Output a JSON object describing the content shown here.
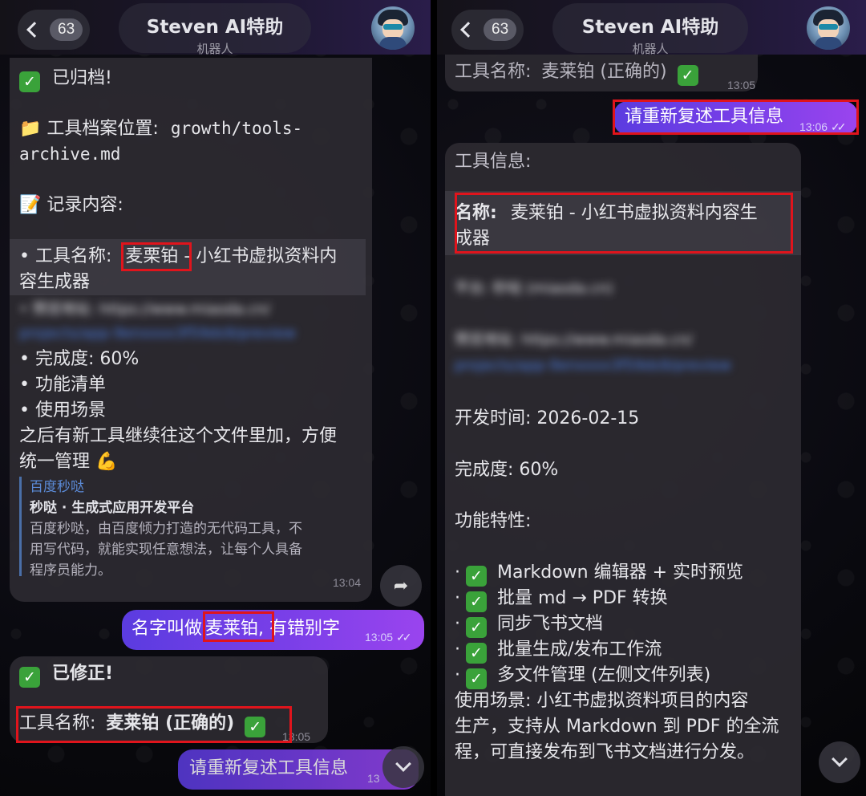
{
  "header": {
    "unread_count": "63",
    "chat_name": "Steven AI特助",
    "chat_subtitle": "机器人"
  },
  "left": {
    "archive_msg": {
      "line1": "已归档!",
      "loc_label": "📁 工具档案位置:",
      "loc_path_1": "growth/tools-",
      "loc_path_2": "archive.md",
      "record_label": "📝 记录内容:",
      "tool_name_prefix": "• 工具名称:",
      "tool_name_value": "麦栗铂",
      "tool_name_suffix": " - 小红书虚拟资料内",
      "tool_name_cont": "容生成器",
      "preview_blurred": "• 预览地址: https://www.miaoda.cn/",
      "preview_blurred_2": "projects/app-9enxxxx3f59ds9/preview",
      "completion": "• 完成度: 60%",
      "features": "• 功能清单",
      "scenarios": "• 使用场景",
      "footer_1": "之后有新工具继续往这个文件里加，方便",
      "footer_2": "统一管理 💪",
      "quote_title": "百度秒哒",
      "quote_head": "秒哒 · 生成式应用开发平台",
      "quote_body_1": "百度秒哒，由百度倾力打造的无代码工具，不",
      "quote_body_2": "用写代码，就能实现任意想法，让每个人具备",
      "quote_body_3": "程序员能力。",
      "time": "13:04"
    },
    "user_msg": {
      "prefix": "名字叫做",
      "highlight": "麦莱铂,",
      "suffix": " 有错别字",
      "time": "13:05"
    },
    "fixed_msg": {
      "line1": "已修正!",
      "label": "工具名称:",
      "value": "麦莱铂 (正确的)",
      "time": "13:05"
    },
    "partial_out": {
      "text": "请重新复述工具信息",
      "time": "13"
    }
  },
  "right": {
    "top_msg": {
      "label": "工具名称:",
      "value": "麦莱铂 (正确的)",
      "time": "13:05"
    },
    "out_msg": {
      "text": "请重新复述工具信息",
      "time": "13:06"
    },
    "info_msg": {
      "heading": "工具信息:",
      "name_label": "名称:",
      "name_value": "麦莱铂 - 小红书虚拟资料内容生",
      "name_cont": "成器",
      "platform_blurred": "平台: 秒哒 (miaoda.cn)",
      "preview_blurred_1": "预览地址: https://www.miaoda.cn/",
      "preview_blurred_2": "projects/app-9enxxxx3f59ds9/preview",
      "dev_time": "开发时间: 2026-02-15",
      "completion": "完成度: 60%",
      "features_heading": "功能特性:",
      "features": [
        "Markdown 编辑器 + 实时预览",
        "批量 md → PDF 转换",
        "同步飞书文档",
        "批量生成/发布工作流",
        "多文件管理 (左侧文件列表)"
      ],
      "usage_1": "使用场景: 小红书虚拟资料项目的内容",
      "usage_2": "生产，支持从 Markdown 到 PDF 的全流",
      "usage_3": "程，可直接发布到飞书文档进行分发。"
    }
  },
  "icons": {
    "check": "✓",
    "ticks": "✓✓"
  },
  "colors": {
    "highlight_box": "#e0141c",
    "out_bubble_start": "#5b3ce0",
    "out_bubble_end": "#9a44ee",
    "check_green": "#3aa23a"
  }
}
